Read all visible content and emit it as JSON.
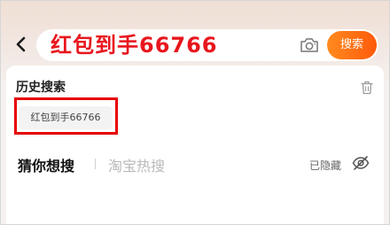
{
  "header": {
    "back_icon": "chevron-left-icon",
    "search": {
      "value": "红包到手66766",
      "value_color": "#e8161e",
      "camera_icon": "camera-icon",
      "button_label": "搜索",
      "button_color": "#ff6a14"
    }
  },
  "history": {
    "title": "历史搜索",
    "clear_icon": "trash-icon",
    "items": [
      {
        "label": "红包到手66766"
      }
    ],
    "highlight_color": "#e60000"
  },
  "discover": {
    "tabs": [
      {
        "label": "猜你想搜",
        "active": true
      },
      {
        "label": "淘宝热搜",
        "active": false
      }
    ],
    "hidden_status": "已隐藏",
    "visibility_icon": "eye-off-icon"
  }
}
